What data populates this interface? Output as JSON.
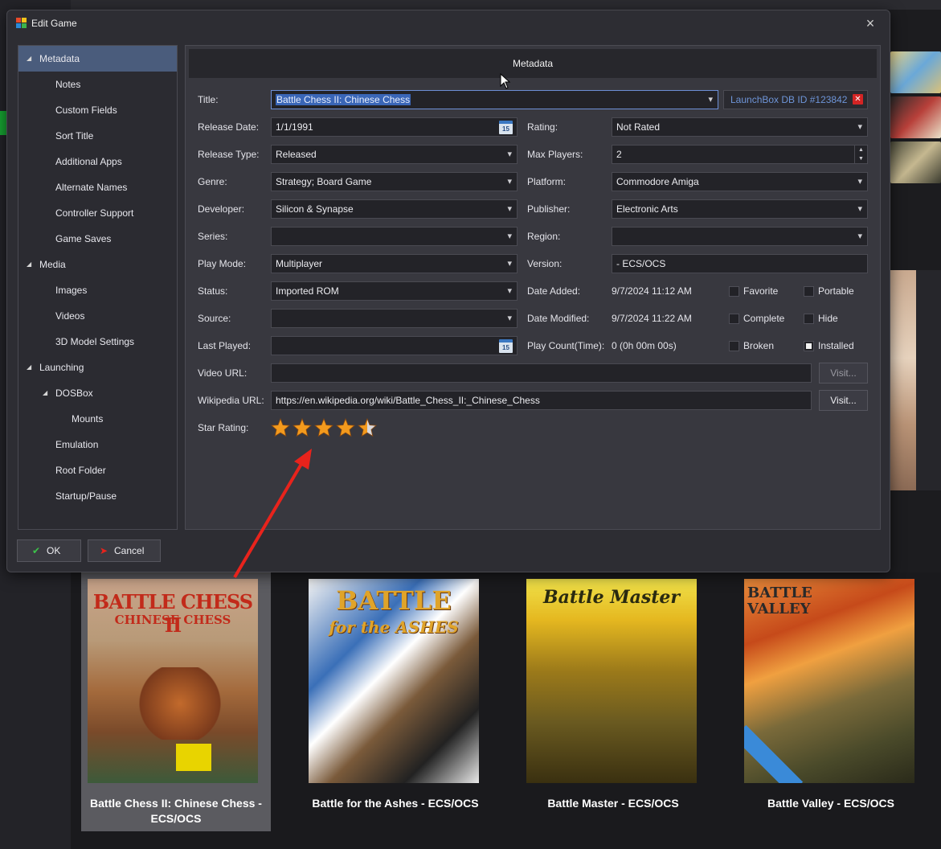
{
  "dialog": {
    "title": "Edit Game",
    "close_icon": "×"
  },
  "nav": {
    "items": [
      {
        "label": "Metadata",
        "expander": "◢"
      },
      {
        "label": "Notes"
      },
      {
        "label": "Custom Fields"
      },
      {
        "label": "Sort Title"
      },
      {
        "label": "Additional Apps"
      },
      {
        "label": "Alternate Names"
      },
      {
        "label": "Controller Support"
      },
      {
        "label": "Game Saves"
      },
      {
        "label": "Media",
        "expander": "◢"
      },
      {
        "label": "Images"
      },
      {
        "label": "Videos"
      },
      {
        "label": "3D Model Settings"
      },
      {
        "label": "Launching",
        "expander": "◢"
      },
      {
        "label": "DOSBox",
        "expander": "◢"
      },
      {
        "label": "Mounts"
      },
      {
        "label": "Emulation"
      },
      {
        "label": "Root Folder"
      },
      {
        "label": "Startup/Pause"
      }
    ]
  },
  "panel": {
    "header": "Metadata"
  },
  "form": {
    "title_label": "Title:",
    "title_value": "Battle Chess II: Chinese Chess",
    "launchbox_id": "LaunchBox DB ID #123842",
    "release_date_label": "Release Date:",
    "release_date_value": "1/1/1991",
    "calendar_day": "15",
    "rating_label": "Rating:",
    "rating_value": "Not Rated",
    "release_type_label": "Release Type:",
    "release_type_value": "Released",
    "max_players_label": "Max Players:",
    "max_players_value": "2",
    "genre_label": "Genre:",
    "genre_value": "Strategy; Board Game",
    "platform_label": "Platform:",
    "platform_value": "Commodore Amiga",
    "developer_label": "Developer:",
    "developer_value": "Silicon & Synapse",
    "publisher_label": "Publisher:",
    "publisher_value": "Electronic Arts",
    "series_label": "Series:",
    "series_value": "",
    "region_label": "Region:",
    "region_value": "",
    "play_mode_label": "Play Mode:",
    "play_mode_value": "Multiplayer",
    "version_label": "Version:",
    "version_value": "- ECS/OCS",
    "status_label": "Status:",
    "status_value": "Imported ROM",
    "date_added_label": "Date Added:",
    "date_added_value": "9/7/2024 11:12 AM",
    "source_label": "Source:",
    "source_value": "",
    "date_modified_label": "Date Modified:",
    "date_modified_value": "9/7/2024 11:22 AM",
    "last_played_label": "Last Played:",
    "last_played_value": "",
    "play_count_label": "Play Count(Time):",
    "play_count_value": "0 (0h 00m 00s)",
    "video_url_label": "Video URL:",
    "video_url_value": "",
    "wikipedia_url_label": "Wikipedia URL:",
    "wikipedia_url_value": "https://en.wikipedia.org/wiki/Battle_Chess_II:_Chinese_Chess",
    "visit_label": "Visit...",
    "star_rating_label": "Star Rating:",
    "star_rating": 4.5,
    "star_max": 5,
    "checkboxes": {
      "favorite": {
        "label": "Favorite",
        "checked": false
      },
      "portable": {
        "label": "Portable",
        "checked": false
      },
      "complete": {
        "label": "Complete",
        "checked": false
      },
      "hide": {
        "label": "Hide",
        "checked": false
      },
      "broken": {
        "label": "Broken",
        "checked": false
      },
      "installed": {
        "label": "Installed",
        "checked": true
      }
    }
  },
  "buttons": {
    "ok": "OK",
    "ok_icon": "✔",
    "cancel": "Cancel",
    "cancel_icon": "➤"
  },
  "gallery": [
    {
      "label": "Battle Chess II: Chinese Chess - ECS/OCS",
      "cover_text": "BATTLE CHESS II",
      "cover_sub": "CHINESE CHESS",
      "selected": true
    },
    {
      "label": "Battle for the Ashes - ECS/OCS",
      "cover_text": "BATTLE",
      "cover_sub": "for the ASHES",
      "selected": false
    },
    {
      "label": "Battle Master - ECS/OCS",
      "cover_text": "Battle Master",
      "cover_sub": "",
      "selected": false
    },
    {
      "label": "Battle Valley - ECS/OCS",
      "cover_text": "BATTLE VALLEY",
      "cover_sub": "",
      "selected": false
    }
  ],
  "colors": {
    "accent": "#4a5c7c",
    "arrow": "#e8231c",
    "star": "#f39a1d",
    "selected_text": "#3a66b7"
  }
}
